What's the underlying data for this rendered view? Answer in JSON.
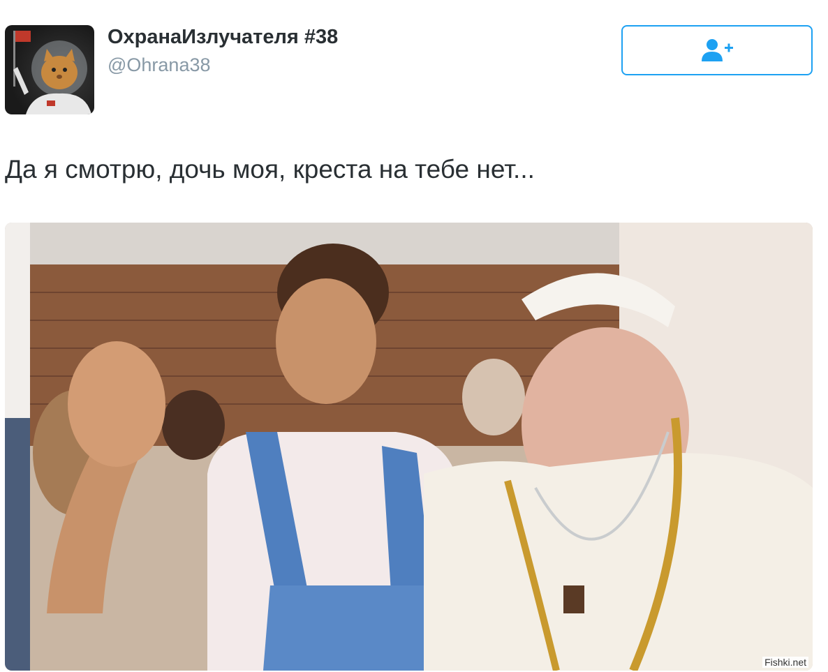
{
  "user": {
    "display_name": "ОхранаИзлучателя #38",
    "handle": "@Ohrana38"
  },
  "follow_button": {
    "icon": "add-user-icon"
  },
  "tweet": {
    "text": "Да я смотрю, дочь моя, креста на тебе нет..."
  },
  "media": {
    "description_kind": "photo",
    "watermark": "Fishki.net"
  },
  "colors": {
    "accent": "#1da1f2",
    "text": "#292f33",
    "secondary": "#8899a6"
  }
}
